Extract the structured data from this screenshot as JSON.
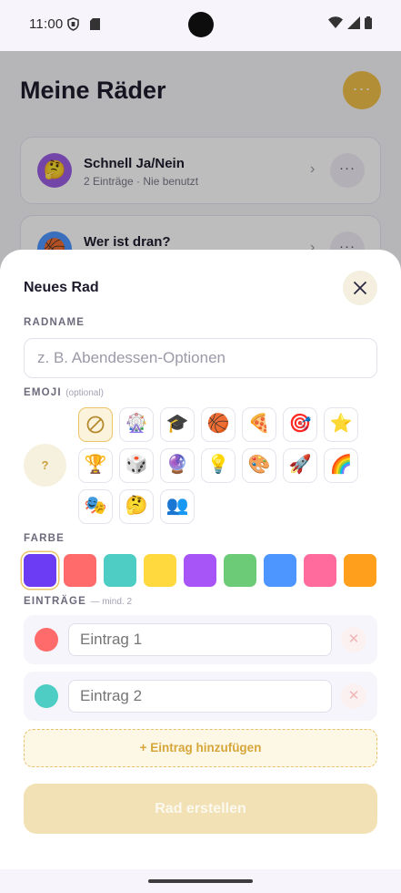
{
  "status_bar": {
    "time": "11:00"
  },
  "background": {
    "title": "Meine Räder",
    "menu_glyph": "···",
    "wheels": [
      {
        "emoji": "🤔",
        "name": "Schnell Ja/Nein",
        "meta": "2 Einträge · Nie benutzt",
        "chevron": "›",
        "more": "···",
        "color": "#9b5de5"
      },
      {
        "emoji": "🏀",
        "name": "Wer ist dran?",
        "meta": "",
        "chevron": "›",
        "more": "···",
        "color": "#4d96ff"
      }
    ]
  },
  "sheet": {
    "title": "Neues Rad",
    "name_label": "RADNAME",
    "name_placeholder": "z. B. Abendessen-Optionen",
    "name_value": "",
    "emoji_label": "EMOJI",
    "emoji_hint": "(optional)",
    "emoji_preview": "?",
    "emojis": [
      "🎡",
      "🎓",
      "🏀",
      "🍕",
      "🎯",
      "⭐",
      "🏆",
      "🎲",
      "🔮",
      "💡",
      "🎨",
      "🚀",
      "🌈",
      "🎭",
      "🤔",
      "👥"
    ],
    "color_label": "FARBE",
    "colors": [
      "#6c3cf5",
      "#ff6b6b",
      "#4ecdc4",
      "#ffd93d",
      "#a855f7",
      "#6bcb77",
      "#4d96ff",
      "#ff6b9d",
      "#ff9f1c"
    ],
    "selected_color_index": 0,
    "entries_label": "EINTRÄGE",
    "entries_hint": "— mind. 2",
    "entries": [
      {
        "placeholder": "Eintrag 1",
        "value": "",
        "color": "#ff6b6b",
        "remove": "✕"
      },
      {
        "placeholder": "Eintrag 2",
        "value": "",
        "color": "#4ecdc4",
        "remove": "✕"
      }
    ],
    "add_entry_label": "+ Eintrag hinzufügen",
    "create_label": "Rad erstellen"
  },
  "icons": {
    "close": "close-icon",
    "shield": "shield-icon",
    "sd_card": "sd-card-icon",
    "wifi": "wifi-icon",
    "signal": "signal-icon",
    "battery": "battery-icon",
    "none": "no-emoji-icon"
  },
  "accent_color": "#f0c14b"
}
